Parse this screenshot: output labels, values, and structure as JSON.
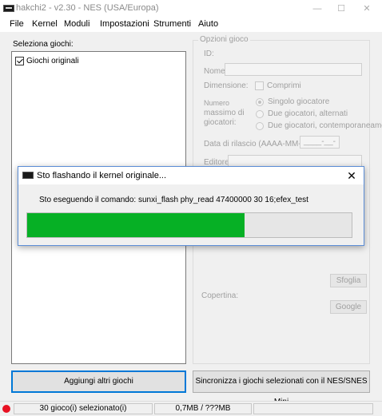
{
  "window": {
    "title": "hakchi2 - v2.30 - NES (USA/Europa)",
    "minimize": "—",
    "maximize": "☐",
    "close": "✕"
  },
  "menu": [
    "File",
    "Kernel",
    "Moduli",
    "Impostazioni",
    "Strumenti",
    "Aiuto"
  ],
  "left_panel": {
    "label": "Seleziona giochi:",
    "items": [
      {
        "label": "Giochi originali",
        "checked": true
      }
    ]
  },
  "game_options": {
    "title": "Opzioni gioco",
    "id_label": "ID:",
    "name_label": "Nome:",
    "dimension_label": "Dimensione:",
    "compress_label": "Comprimi",
    "players_label_1": "Numero",
    "players_label_2": "massimo di",
    "players_label_3": "giocatori:",
    "radio_single": "Singolo giocatore",
    "radio_alternate": "Due giocatori, alternati",
    "radio_simultaneous": "Due giocatori, contemporaneamente",
    "release_label": "Data di rilascio (AAAA-MM-GG):",
    "release_value": "____-__-__",
    "publisher_label": "Editore:",
    "browse_button": "Sfoglia",
    "cover_label": "Copertina:",
    "google_button": "Google"
  },
  "buttons": {
    "add_games": "Aggiungi altri giochi",
    "sync": "Sincronizza i giochi selezionati con il NES/SNES Mini"
  },
  "status": {
    "selected": "30 gioco(i) selezionato(i)",
    "size": "0,7MB / ???MB",
    "indicator_color": "#e81123"
  },
  "dialog": {
    "title": "Sto flashando il kernel originale...",
    "close": "✕",
    "message": "Sto eseguendo il comando: sunxi_flash phy_read 47400000 30 16;efex_test",
    "progress": 0.67,
    "progress_color": "#06b025"
  }
}
